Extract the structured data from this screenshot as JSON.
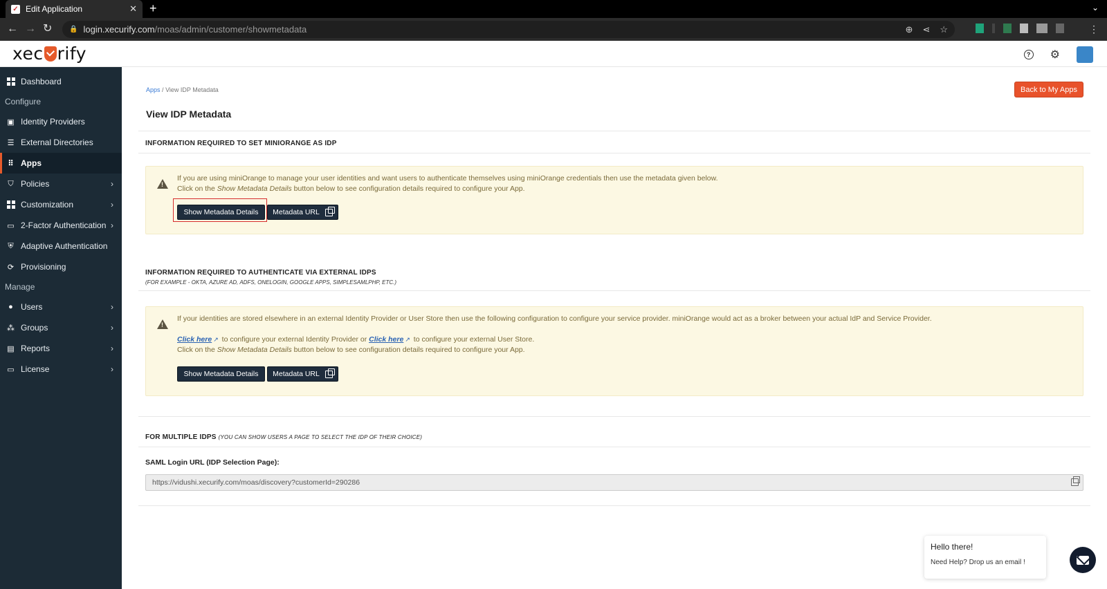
{
  "browser": {
    "tab_title": "Edit Application",
    "tab_close": "✕",
    "new_tab": "+",
    "url_host": "login.xecurify.com",
    "url_path": "/moas/admin/customer/showmetadata"
  },
  "header": {
    "logo_pre": "xec",
    "logo_post": "rify",
    "help_glyph": "?"
  },
  "sidebar": {
    "dashboard": "Dashboard",
    "configure": "Configure",
    "identity_providers": "Identity Providers",
    "external_directories": "External Directories",
    "apps": "Apps",
    "policies": "Policies",
    "customization": "Customization",
    "two_factor": "2-Factor Authentication",
    "adaptive": "Adaptive Authentication",
    "provisioning": "Provisioning",
    "manage": "Manage",
    "users": "Users",
    "groups": "Groups",
    "reports": "Reports",
    "license": "License"
  },
  "main": {
    "breadcrumb_apps": "Apps",
    "breadcrumb_sep": "/",
    "breadcrumb_current": "View IDP Metadata",
    "back_button": "Back to My Apps",
    "title": "View IDP Metadata",
    "section1": {
      "heading": "INFORMATION REQUIRED TO SET MINIORANGE AS IDP",
      "line1": "If you are using miniOrange to manage your user identities and want users to authenticate themselves using miniOrange credentials then use the metadata given below.",
      "line2_pre": "Click on the ",
      "line2_em": "Show Metadata Details",
      "line2_post": " button below to see configuration details required to configure your App.",
      "show_btn": "Show Metadata Details",
      "url_btn": "Metadata URL"
    },
    "section2": {
      "heading": "INFORMATION REQUIRED TO AUTHENTICATE VIA EXTERNAL IDPS",
      "sub": "(FOR EXAMPLE - OKTA, AZURE AD, ADFS, ONELOGIN, GOOGLE APPS, SIMPLESAMLPHP, ETC.)",
      "line1": "If your identities are stored elsewhere in an external Identity Provider or User Store then use the following configuration to configure your service provider. miniOrange would act as a broker between your actual IdP and Service Provider.",
      "click_here": "Click here",
      "mid1": " to configure your external Identity Provider or ",
      "click_here2": "Click here",
      "mid2": " to configure your external User Store.",
      "line3_pre": "Click on the ",
      "line3_em": "Show Metadata Details",
      "line3_post": " button below to see configuration details required to configure your App.",
      "show_btn": "Show Metadata Details",
      "url_btn": "Metadata URL"
    },
    "section3": {
      "heading": "FOR MULTIPLE IDPS",
      "sub": "(YOU CAN SHOW USERS A PAGE TO SELECT THE IDP OF THEIR CHOICE)",
      "label": "SAML Login URL (IDP Selection Page):",
      "url": "https://vidushi.xecurify.com/moas/discovery?customerId=290286"
    }
  },
  "chat": {
    "hello": "Hello there!",
    "help": "Need Help? Drop us an email !"
  },
  "colors": {
    "accent": "#e8522b",
    "sidebar_bg": "#1c2b36",
    "alert_bg": "#fcf8e3",
    "dark_button": "#1f2d3d"
  }
}
